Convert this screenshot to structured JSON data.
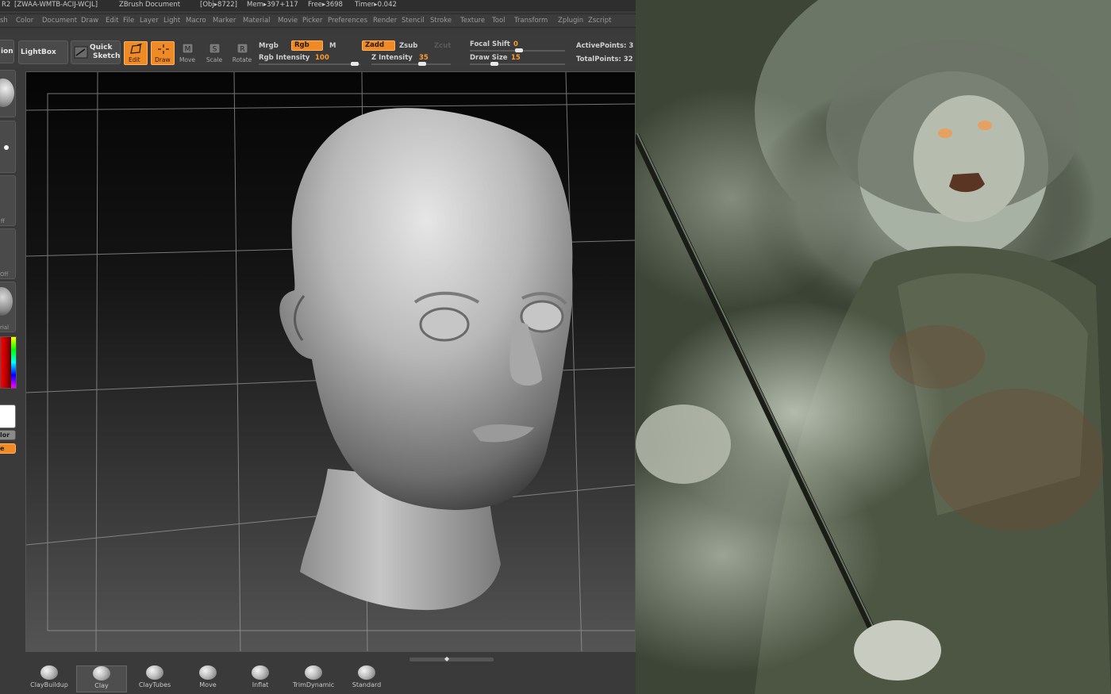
{
  "titlebar": {
    "prefix": "R2",
    "serial": "[ZWAA-WMTB-ACIJ-WCJL]",
    "document": "ZBrush Document",
    "obj": "[Obj▸8722]",
    "mem": "Mem▸397+117",
    "free": "Free▸3698",
    "timer": "Timer▸0.042"
  },
  "menu": [
    "sh",
    "Color",
    "Document",
    "Draw",
    "Edit",
    "File",
    "Layer",
    "Light",
    "Macro",
    "Material",
    "Movie",
    "Marker",
    "Material",
    "Movie",
    "Picker",
    "Preferences",
    "Render",
    "Stencil",
    "Stroke",
    "Texture",
    "Tool",
    "Transform",
    "Zplugin",
    "Zscript"
  ],
  "menu_visible": [
    "sh",
    "Color",
    "Document",
    "Draw",
    "Edit",
    "File",
    "Layer",
    "Light",
    "Macro",
    "Marker",
    "Material",
    "Movie",
    "Picker",
    "Preferences",
    "Render",
    "Stencil",
    "Stroke",
    "Texture",
    "Tool",
    "Transform",
    "Zplugin",
    "Zscript"
  ],
  "toolbar": {
    "projection_label": "ion",
    "lightbox_label": "LightBox",
    "quicksketch_label_1": "Quick",
    "quicksketch_label_2": "Sketch",
    "edit_label": "Edit",
    "draw_label": "Draw",
    "move_label": "Move",
    "scale_label": "Scale",
    "rotate_label": "Rotate",
    "mrgb_label": "Mrgb",
    "rgb_label": "Rgb",
    "m_label": "M",
    "zadd_label": "Zadd",
    "zsub_label": "Zsub",
    "zcut_label": "Zcut",
    "rgb_intensity_label": "Rgb  Intensity",
    "rgb_intensity_value": "100",
    "z_intensity_label": "Z  Intensity",
    "z_intensity_value": "35",
    "focal_shift_label": "Focal  Shift",
    "focal_shift_value": "0",
    "draw_size_label": "Draw  Size",
    "draw_size_value": "15",
    "active_points_label": "ActivePoints: 3",
    "total_points_label": "TotalPoints: 32"
  },
  "leftstrip": {
    "off_label_1": "ff",
    "off_label_2": "Off",
    "material_label": "rial",
    "color_label": "lor",
    "orange_label": "e"
  },
  "brushes": [
    {
      "label": "ClayBuildup"
    },
    {
      "label": "Clay"
    },
    {
      "label": "ClayTubes"
    },
    {
      "label": "Move"
    },
    {
      "label": "Inflat"
    },
    {
      "label": "TrimDynamic"
    },
    {
      "label": "Standard"
    }
  ],
  "colors": {
    "accent": "#f08a24",
    "accent_text": "#ff9a2e",
    "ui_bg": "#3a3a3a"
  },
  "icons": {
    "edit": "edit-pencil-icon",
    "draw": "draw-crosshair-icon",
    "move": "move-icon",
    "scale": "scale-icon",
    "rotate": "rotate-icon",
    "quicksketch": "quicksketch-icon"
  }
}
